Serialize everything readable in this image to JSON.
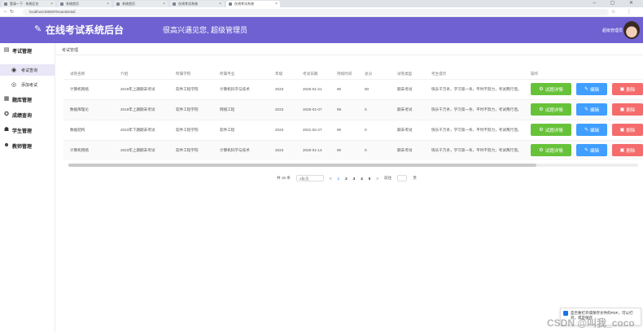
{
  "browser": {
    "tabs": [
      {
        "label": "登录一下 · 系统后台"
      },
      {
        "label": "系统首页"
      },
      {
        "label": "系统首页"
      },
      {
        "label": "在线考试系统"
      },
      {
        "label": "在线考试系统"
      }
    ],
    "url": "localhost:8080/#/examDetail"
  },
  "header": {
    "brand": "在线考试系统后台",
    "welcome": "很高兴遇见您, 超级管理员",
    "username": "超级管理员"
  },
  "sidebar": {
    "groups": [
      {
        "label": "考试管理",
        "icon": "exam-icon",
        "children": [
          {
            "label": "考试查询",
            "icon": "search-icon",
            "active": true
          },
          {
            "label": "添加考试",
            "icon": "add-icon",
            "active": false
          }
        ]
      },
      {
        "label": "题库管理",
        "icon": "bank-icon"
      },
      {
        "label": "成绩查询",
        "icon": "score-icon"
      },
      {
        "label": "学生管理",
        "icon": "student-icon"
      },
      {
        "label": "教师管理",
        "icon": "teacher-icon"
      }
    ]
  },
  "breadcrumb": "考试管理",
  "table": {
    "headers": [
      "试卷名称",
      "介绍",
      "所属学院",
      "所属专业",
      "年级",
      "考试日期",
      "持续时间",
      "总分",
      "试卷类型",
      "考生提示",
      "操作"
    ],
    "rows": [
      [
        "计算机网络",
        "2019年上期期末考试",
        "软件工程学院",
        "计算机科学与技术",
        "2023",
        "2025-01-21",
        "90",
        "80",
        "期末考试",
        "快乐千万条，学习第一条，平时不努力，考试两行泪。"
      ],
      [
        "数据库理论",
        "2019年上期期末考试",
        "软件工程学院",
        "网络工程",
        "2023",
        "2025-01-07",
        "99",
        "0",
        "期末考试",
        "快乐千万条，学习第一条，平时不努力，考试两行泪。"
      ],
      [
        "数据结构",
        "2023年下期期末考试",
        "软件工程学院",
        "软件工程",
        "2023",
        "2021-02-27",
        "90",
        "0",
        "期末考试",
        "快乐千万条，学习第一条，平时不努力，考试两行泪。"
      ],
      [
        "计算机网络",
        "2023年上期期末考试",
        "软件工程学院",
        "计算机科学与技术",
        "2023",
        "2025-01-14",
        "90",
        "0",
        "期末考试",
        "快乐千万条，学习第一条，平时不努力，考试两行泪。"
      ]
    ],
    "actions": {
      "detail": "试题详情",
      "edit": "编辑",
      "delete": "删除"
    }
  },
  "pagination": {
    "total": "共 16 条",
    "page_size": "4条/页",
    "prev": "<",
    "pages": [
      "1",
      "2",
      "3",
      "4",
      "5"
    ],
    "current": "1",
    "next": ">",
    "goto": "前往",
    "page_unit": "页"
  },
  "download_popup": {
    "text": "是否要打开或保存文件的PDF，可以打开，或是保存"
  },
  "watermark": "CSDN @叫我_coco",
  "colors": {
    "header": "#6f61d1",
    "detail": "#67c23a",
    "edit": "#409eff",
    "delete": "#f56c6c"
  }
}
